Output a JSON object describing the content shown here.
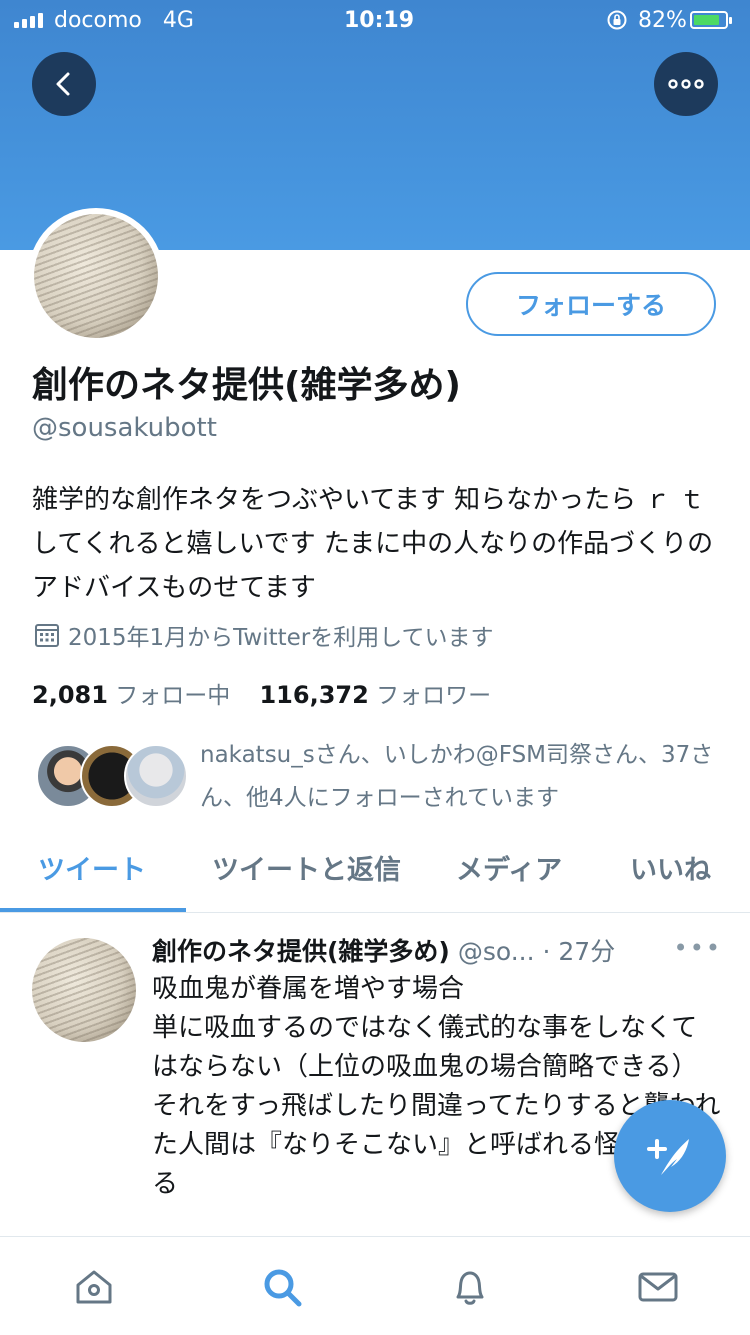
{
  "status_bar": {
    "carrier": "docomo",
    "network": "4G",
    "time": "10:19",
    "battery_percent": "82%",
    "battery_level": 0.82
  },
  "header": {
    "back_icon": "chevron-left-icon",
    "more_icon": "more-dots-icon"
  },
  "profile": {
    "follow_label": "フォローする",
    "name": "創作のネタ提供(雑学多め)",
    "handle": "@sousakubott",
    "bio": "雑学的な創作ネタをつぶやいてます 知らなかったら ｒ ｔしてくれると嬉しいです たまに中の人なりの作品づくりのアドバイスものせてます",
    "joined": "2015年1月からTwitterを利用しています",
    "following_count": "2,081",
    "following_label": "フォロー中",
    "followers_count": "116,372",
    "followers_label": "フォロワー",
    "followed_by": "nakatsu_sさん、いしかわ@FSM司祭さん、37さん、他4人にフォローされています"
  },
  "tabs": [
    {
      "label": "ツイート",
      "active": true
    },
    {
      "label": "ツイートと返信",
      "active": false
    },
    {
      "label": "メディア",
      "active": false
    },
    {
      "label": "いいね",
      "active": false
    }
  ],
  "tweet": {
    "name": "創作のネタ提供(雑学多め)",
    "handle": "@so...",
    "time": "· 27分",
    "more": "•••",
    "lines": [
      "吸血鬼が眷属を増やす場合",
      "単に吸血するのではなく儀式的な事をしなくてはならない（上位の吸血鬼の場合簡略できる）",
      "それをすっ飛ばしたり間違ってたりすると襲われた人間は『なりそこない』と呼ばれる怪物となる"
    ]
  },
  "fab": {
    "icon": "compose-tweet-icon"
  },
  "bottom_nav": [
    {
      "name": "home-icon"
    },
    {
      "name": "search-icon"
    },
    {
      "name": "notifications-icon"
    },
    {
      "name": "messages-icon"
    }
  ],
  "colors": {
    "accent": "#4a9ae3",
    "banner": "#4592db",
    "secondary_text": "#657786"
  }
}
